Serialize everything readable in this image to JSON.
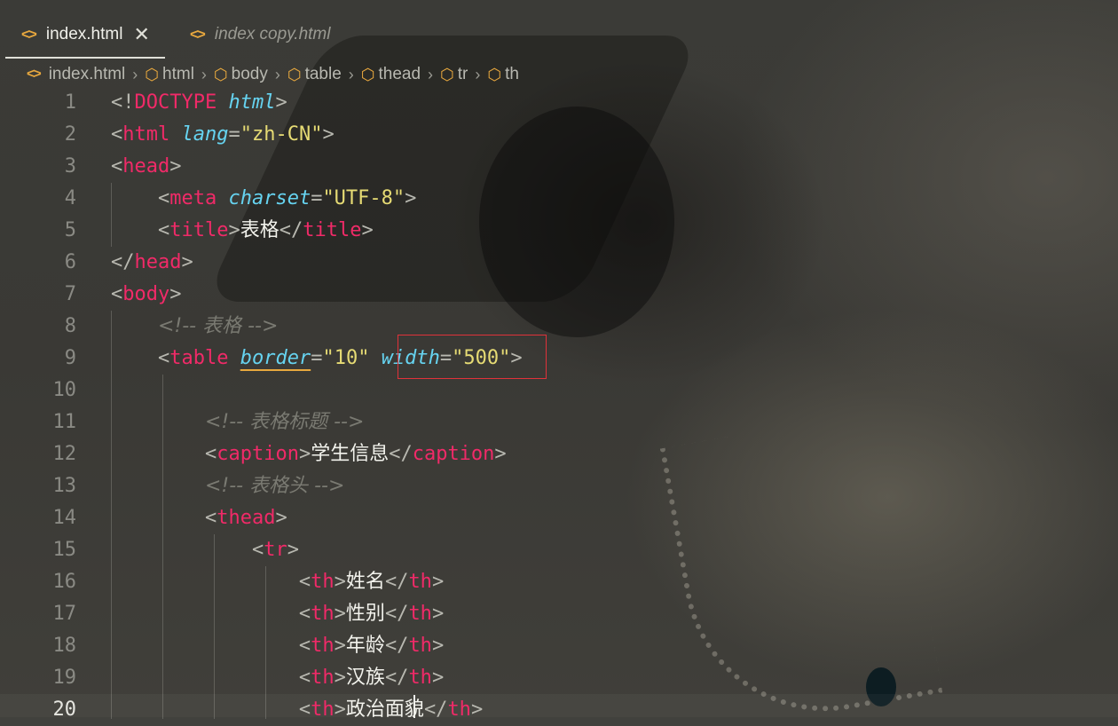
{
  "tabs": [
    {
      "label": "index.html",
      "active": true
    },
    {
      "label": "index copy.html",
      "active": false
    }
  ],
  "breadcrumb": [
    "index.html",
    "html",
    "body",
    "table",
    "thead",
    "tr",
    "th"
  ],
  "colors": {
    "tag": "#f02a68",
    "attr": "#66d3f0",
    "string": "#e6db74",
    "comment": "#7a7a72",
    "icon": "#e8a83e"
  },
  "editor": {
    "current_line": 20,
    "lines": [
      {
        "n": "1",
        "tokens": [
          [
            "p",
            "<!"
          ],
          [
            "t",
            "DOCTYPE"
          ],
          [
            "x",
            " "
          ],
          [
            "a",
            "html"
          ],
          [
            "p",
            ">"
          ]
        ]
      },
      {
        "n": "2",
        "tokens": [
          [
            "p",
            "<"
          ],
          [
            "t",
            "html"
          ],
          [
            "x",
            " "
          ],
          [
            "a",
            "lang"
          ],
          [
            "p",
            "="
          ],
          [
            "s",
            "\"zh-CN\""
          ],
          [
            "p",
            ">"
          ]
        ]
      },
      {
        "n": "3",
        "tokens": [
          [
            "p",
            "<"
          ],
          [
            "t",
            "head"
          ],
          [
            "p",
            ">"
          ]
        ]
      },
      {
        "n": "4",
        "tokens": [
          [
            "x",
            "    "
          ],
          [
            "p",
            "<"
          ],
          [
            "t",
            "meta"
          ],
          [
            "x",
            " "
          ],
          [
            "a",
            "charset"
          ],
          [
            "p",
            "="
          ],
          [
            "s",
            "\"UTF-8\""
          ],
          [
            "p",
            ">"
          ]
        ]
      },
      {
        "n": "5",
        "tokens": [
          [
            "x",
            "    "
          ],
          [
            "p",
            "<"
          ],
          [
            "t",
            "title"
          ],
          [
            "p",
            ">"
          ],
          [
            "x",
            "表格"
          ],
          [
            "p",
            "</"
          ],
          [
            "t",
            "title"
          ],
          [
            "p",
            ">"
          ]
        ]
      },
      {
        "n": "6",
        "tokens": [
          [
            "p",
            "</"
          ],
          [
            "t",
            "head"
          ],
          [
            "p",
            ">"
          ]
        ]
      },
      {
        "n": "7",
        "tokens": [
          [
            "p",
            "<"
          ],
          [
            "t",
            "body"
          ],
          [
            "p",
            ">"
          ]
        ]
      },
      {
        "n": "8",
        "tokens": [
          [
            "x",
            "    "
          ],
          [
            "c",
            "<!-- 表格 -->"
          ]
        ]
      },
      {
        "n": "9",
        "tokens": [
          [
            "x",
            "    "
          ],
          [
            "p",
            "<"
          ],
          [
            "t",
            "table"
          ],
          [
            "x",
            " "
          ],
          [
            "aw",
            "border"
          ],
          [
            "p",
            "="
          ],
          [
            "s",
            "\"10\""
          ],
          [
            "x",
            " "
          ],
          [
            "a",
            "width"
          ],
          [
            "p",
            "="
          ],
          [
            "s",
            "\"500\""
          ],
          [
            "p",
            ">"
          ]
        ]
      },
      {
        "n": "10",
        "tokens": []
      },
      {
        "n": "11",
        "tokens": [
          [
            "x",
            "        "
          ],
          [
            "c",
            "<!-- 表格标题 -->"
          ]
        ]
      },
      {
        "n": "12",
        "tokens": [
          [
            "x",
            "        "
          ],
          [
            "p",
            "<"
          ],
          [
            "t",
            "caption"
          ],
          [
            "p",
            ">"
          ],
          [
            "x",
            "学生信息"
          ],
          [
            "p",
            "</"
          ],
          [
            "t",
            "caption"
          ],
          [
            "p",
            ">"
          ]
        ]
      },
      {
        "n": "13",
        "tokens": [
          [
            "x",
            "        "
          ],
          [
            "c",
            "<!-- 表格头 -->"
          ]
        ]
      },
      {
        "n": "14",
        "tokens": [
          [
            "x",
            "        "
          ],
          [
            "p",
            "<"
          ],
          [
            "t",
            "thead"
          ],
          [
            "p",
            ">"
          ]
        ]
      },
      {
        "n": "15",
        "tokens": [
          [
            "x",
            "            "
          ],
          [
            "p",
            "<"
          ],
          [
            "t",
            "tr"
          ],
          [
            "p",
            ">"
          ]
        ]
      },
      {
        "n": "16",
        "tokens": [
          [
            "x",
            "                "
          ],
          [
            "p",
            "<"
          ],
          [
            "t",
            "th"
          ],
          [
            "p",
            ">"
          ],
          [
            "x",
            "姓名"
          ],
          [
            "p",
            "</"
          ],
          [
            "t",
            "th"
          ],
          [
            "p",
            ">"
          ]
        ]
      },
      {
        "n": "17",
        "tokens": [
          [
            "x",
            "                "
          ],
          [
            "p",
            "<"
          ],
          [
            "t",
            "th"
          ],
          [
            "p",
            ">"
          ],
          [
            "x",
            "性别"
          ],
          [
            "p",
            "</"
          ],
          [
            "t",
            "th"
          ],
          [
            "p",
            ">"
          ]
        ]
      },
      {
        "n": "18",
        "tokens": [
          [
            "x",
            "                "
          ],
          [
            "p",
            "<"
          ],
          [
            "t",
            "th"
          ],
          [
            "p",
            ">"
          ],
          [
            "x",
            "年龄"
          ],
          [
            "p",
            "</"
          ],
          [
            "t",
            "th"
          ],
          [
            "p",
            ">"
          ]
        ]
      },
      {
        "n": "19",
        "tokens": [
          [
            "x",
            "                "
          ],
          [
            "p",
            "<"
          ],
          [
            "t",
            "th"
          ],
          [
            "p",
            ">"
          ],
          [
            "x",
            "汉族"
          ],
          [
            "p",
            "</"
          ],
          [
            "t",
            "th"
          ],
          [
            "p",
            ">"
          ]
        ]
      },
      {
        "n": "20",
        "tokens": [
          [
            "x",
            "                "
          ],
          [
            "p",
            "<"
          ],
          [
            "t",
            "th"
          ],
          [
            "p",
            ">"
          ],
          [
            "x",
            "政治面貌"
          ],
          [
            "p",
            "</"
          ],
          [
            "t",
            "th"
          ],
          [
            "p",
            ">"
          ]
        ]
      }
    ]
  }
}
